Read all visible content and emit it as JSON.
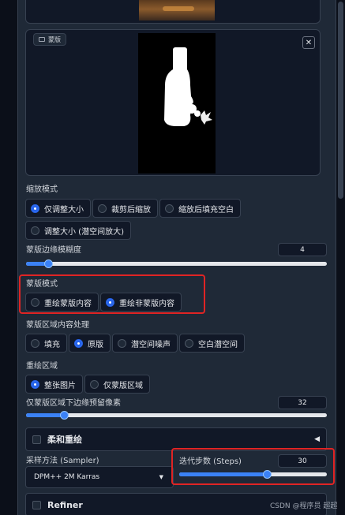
{
  "mask": {
    "label": "蒙版",
    "close_icon": "close-icon"
  },
  "resize_mode": {
    "label": "缩放模式",
    "options": [
      "仅调整大小",
      "裁剪后缩放",
      "缩放后填充空白",
      "调整大小 (潜空间放大)"
    ],
    "selected": "仅调整大小"
  },
  "mask_blur": {
    "label": "蒙版边缘模糊度",
    "value": "4",
    "fraction": 0.07
  },
  "mask_mode": {
    "label": "蒙版模式",
    "options": [
      "重绘蒙版内容",
      "重绘非蒙版内容"
    ],
    "selected": "重绘非蒙版内容"
  },
  "masked_content": {
    "label": "蒙版区域内容处理",
    "options": [
      "填充",
      "原版",
      "潜空间噪声",
      "空白潜空间"
    ],
    "selected": "原版"
  },
  "inpaint_area": {
    "label": "重绘区域",
    "options": [
      "整张图片",
      "仅蒙版区域"
    ],
    "selected": "整张图片"
  },
  "padding": {
    "label": "仅蒙版区域下边缘预留像素",
    "value": "32",
    "fraction": 0.125
  },
  "soft_inpaint": {
    "label": "柔和重绘",
    "caret": "◀"
  },
  "sampler": {
    "label": "采样方法 (Sampler)",
    "value": "DPM++ 2M Karras",
    "arrow": "▼"
  },
  "steps": {
    "label": "迭代步数 (Steps)",
    "value": "30",
    "fraction": 0.58
  },
  "refiner": {
    "label": "Refiner"
  },
  "watermark": "CSDN @程序员 超超",
  "colors": {
    "accent": "#3b82f6",
    "highlight": "#e02424",
    "background": "#0b0f19"
  }
}
